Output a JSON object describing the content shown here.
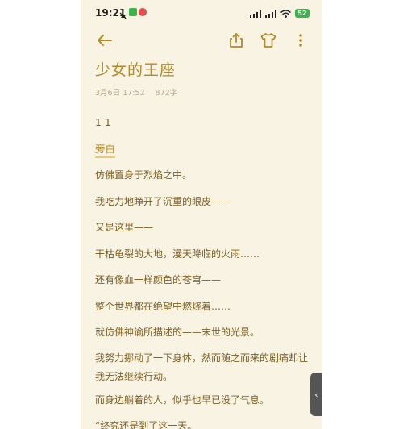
{
  "status": {
    "time": "19:21",
    "battery": "52"
  },
  "toolbar": {
    "icons": [
      "back-arrow-icon",
      "share-icon",
      "shirt-icon",
      "more-vertical-icon"
    ],
    "accent": "#b58a25"
  },
  "note": {
    "title": "少女的王座",
    "date": "3月6日 17:52",
    "word_count": "872字",
    "section_number": "1-1",
    "section_heading": "旁白",
    "paragraphs": [
      "仿佛置身于烈焰之中。",
      "我吃力地睁开了沉重的眼皮——",
      "又是这里——",
      "干枯龟裂的大地，漫天降临的火雨……",
      "还有像血一样颜色的苍穹——",
      "整个世界都在绝望中燃烧着……",
      "就仿佛神谕所描述的——末世的光景。",
      "我努力挪动了一下身体，然而随之而来的剧痛却让我无法继续行动。",
      "而身边躺着的人，似乎也早已没了气息。",
      "“终究还是到了这一天。"
    ]
  },
  "side_tab": {
    "icon": "chevron-left-icon",
    "label": "‹"
  }
}
